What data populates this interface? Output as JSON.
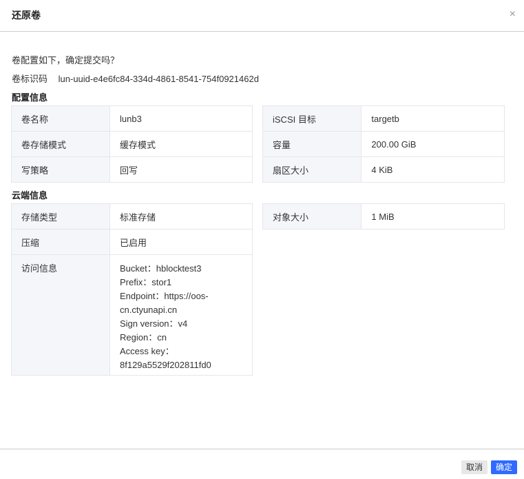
{
  "dialog": {
    "title": "还原卷",
    "close_icon": "×"
  },
  "prompt": "卷配置如下，确定提交吗？",
  "uuid": {
    "label": "卷标识码",
    "value": "lun-uuid-e4e6fc84-334d-4861-8541-754f0921462d"
  },
  "config": {
    "title": "配置信息",
    "left": [
      {
        "k": "卷名称",
        "v": "lunb3"
      },
      {
        "k": "卷存储模式",
        "v": "缓存模式"
      },
      {
        "k": "写策略",
        "v": "回写"
      }
    ],
    "right": [
      {
        "k": "iSCSI 目标",
        "v": "targetb"
      },
      {
        "k": "容量",
        "v": "200.00 GiB"
      },
      {
        "k": "扇区大小",
        "v": "4 KiB"
      }
    ]
  },
  "cloud": {
    "title": "云端信息",
    "left": [
      {
        "k": "存储类型",
        "v": "标准存储"
      },
      {
        "k": "压缩",
        "v": "已启用"
      }
    ],
    "access": {
      "k": "访问信息",
      "lines": [
        "Bucket：hblocktest3",
        "Prefix：stor1",
        "Endpoint：https://oos-cn.ctyunapi.cn",
        "Sign version：v4",
        "Region：cn",
        "Access key：8f129a5529f202811fd0"
      ]
    },
    "right": [
      {
        "k": "对象大小",
        "v": "1 MiB"
      }
    ]
  },
  "footer": {
    "cancel": "取消",
    "ok": "确定"
  }
}
